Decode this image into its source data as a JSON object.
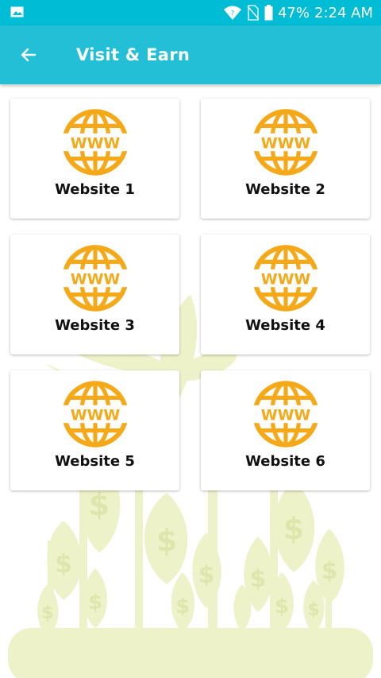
{
  "status_bar": {
    "battery": "47%",
    "time": "2:24 AM",
    "icons": [
      "gallery-icon",
      "wifi-icon",
      "no-sim-icon",
      "battery-icon"
    ]
  },
  "toolbar": {
    "title": "Visit & Earn",
    "back_icon": "arrow-left-icon"
  },
  "websites": [
    {
      "label": "Website 1",
      "icon": "www-globe-icon"
    },
    {
      "label": "Website 2",
      "icon": "www-globe-icon"
    },
    {
      "label": "Website 3",
      "icon": "www-globe-icon"
    },
    {
      "label": "Website 4",
      "icon": "www-globe-icon"
    },
    {
      "label": "Website 5",
      "icon": "www-globe-icon"
    },
    {
      "label": "Website 6",
      "icon": "www-globe-icon"
    }
  ],
  "colors": {
    "toolbar": "#22bfd6",
    "status_bar": "#00bcd4",
    "icon_orange": "#f5a818",
    "background_art": "#eef2c8"
  }
}
